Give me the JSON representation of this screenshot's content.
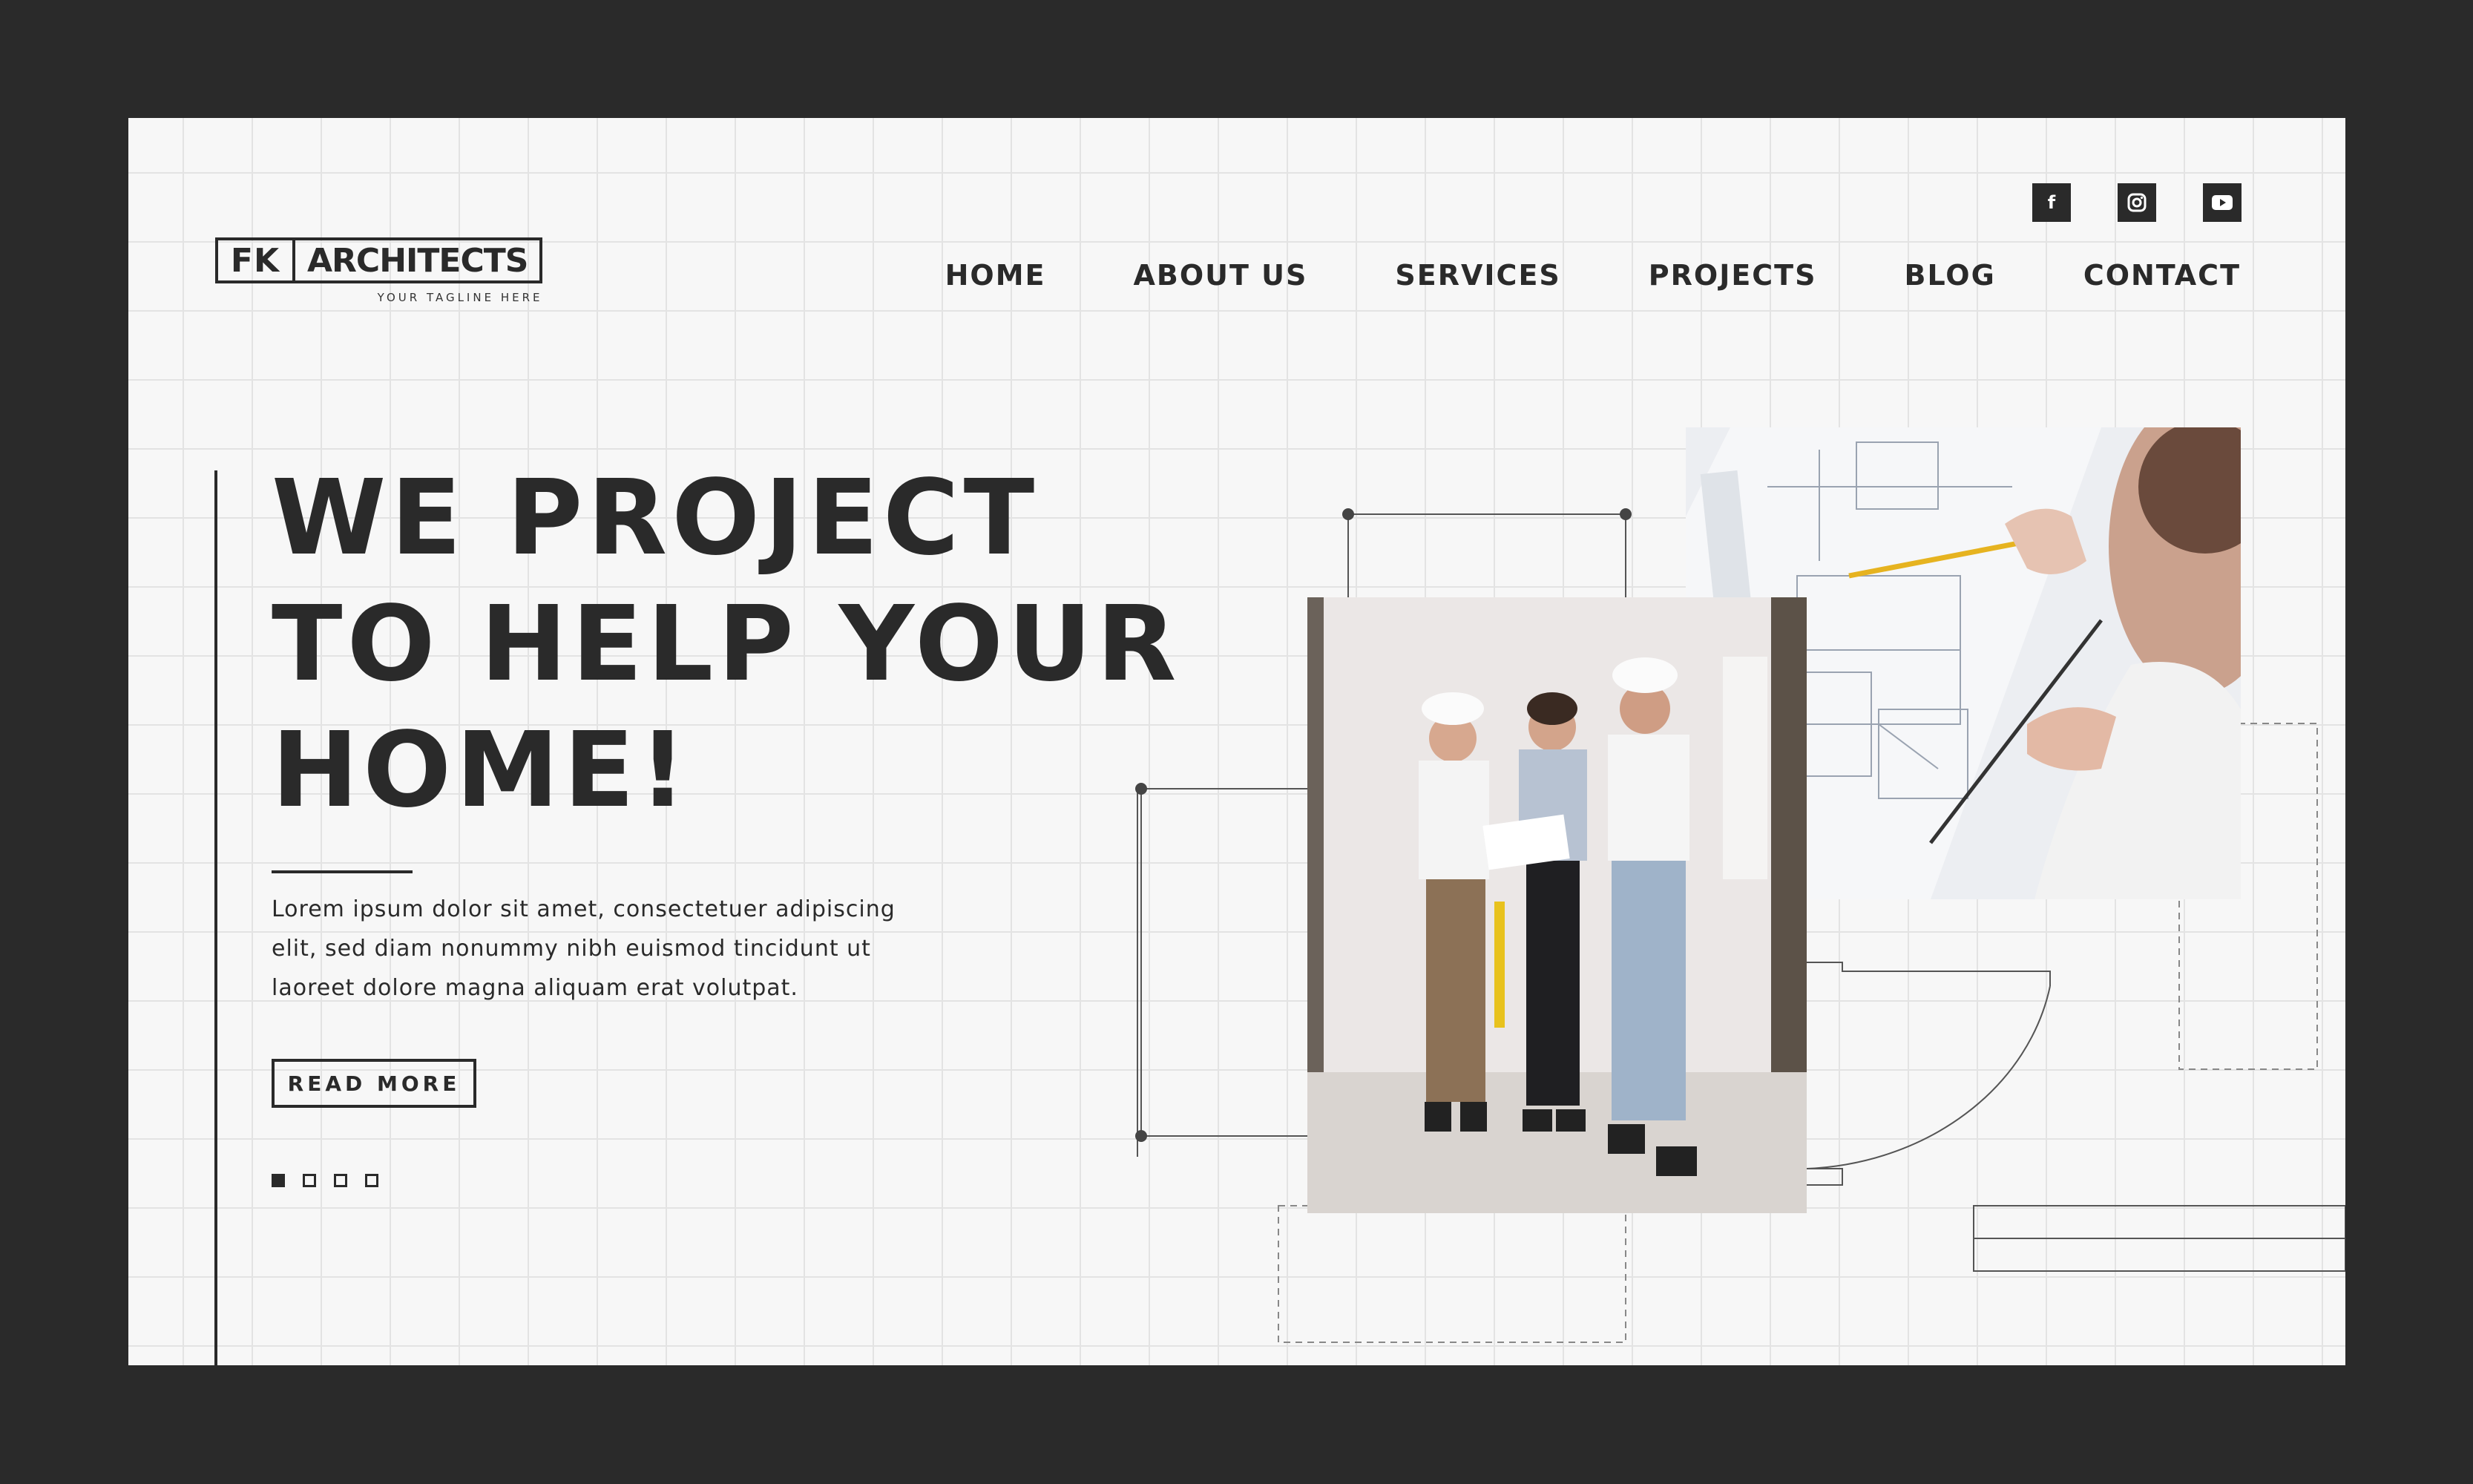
{
  "brand": {
    "initials": "FK",
    "name": "ARCHITECTS",
    "tagline": "YOUR TAGLINE HERE"
  },
  "social": [
    {
      "icon": "facebook-icon",
      "glyph": "f"
    },
    {
      "icon": "instagram-icon",
      "glyph": "◎"
    },
    {
      "icon": "youtube-icon",
      "glyph": "▶"
    }
  ],
  "nav": {
    "items": [
      "HOME",
      "ABOUT US",
      "SERVICES",
      "PROJECTS",
      "BLOG",
      "CONTACT"
    ]
  },
  "hero": {
    "line1": "WE PROJECT",
    "line2": "TO HELP YOUR",
    "line3": "HOME!",
    "body": "Lorem ipsum dolor sit amet, consectetuer adipiscing elit, sed diam nonummy nibh euismod tincidunt ut laoreet dolore magna aliquam erat volutpat.",
    "cta": "READ MORE",
    "slides": 4,
    "active_slide": 1
  },
  "colors": {
    "frame": "#2a2a2a",
    "page_bg": "#f7f7f7",
    "grid": "#e3e3e3",
    "ink": "#2a2a2a"
  }
}
